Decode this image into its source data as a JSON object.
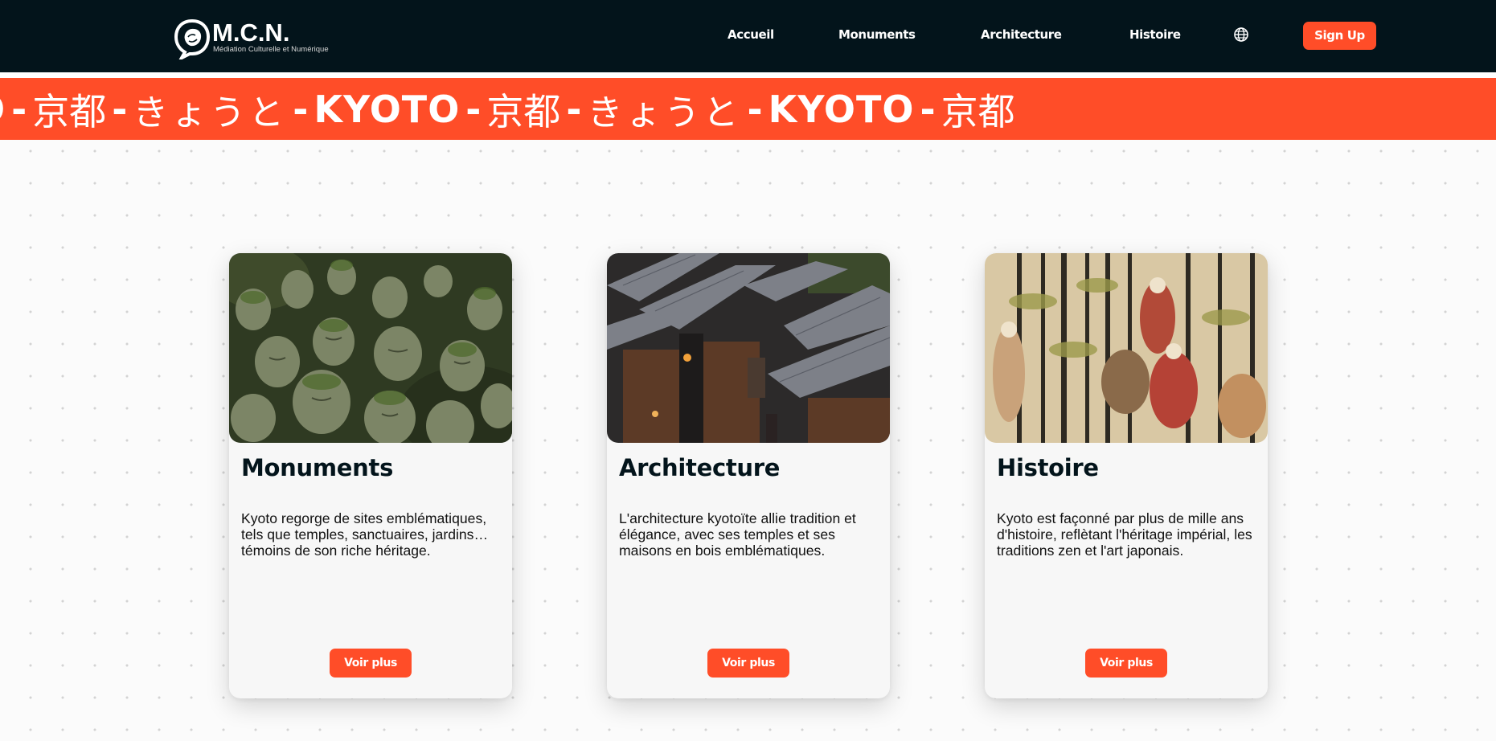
{
  "header": {
    "logo": {
      "title": "M.C.N.",
      "subtitle": "Médiation Culturelle et Numérique",
      "icon": "speech-bubble-logo"
    },
    "nav": [
      {
        "label": "Accueil"
      },
      {
        "label": "Monuments"
      },
      {
        "label": "Architecture"
      },
      {
        "label": "Histoire"
      }
    ],
    "language_icon": "globe-icon",
    "signup_label": "Sign Up"
  },
  "marquee": {
    "segments": [
      "O",
      "京都",
      "きょうと",
      "KYOTO",
      "京都",
      "きょうと",
      "KYOTO",
      "京都"
    ],
    "separator": "-"
  },
  "cards": [
    {
      "title": "Monuments",
      "text": "Kyoto regorge de sites emblématiques, tels que temples, sanctuaires, jardins…témoins de son riche héritage.",
      "button": "Voir plus",
      "image": "photo-moss-covered-stone-buddha-statues"
    },
    {
      "title": "Architecture",
      "text": "L'architecture kyotoïte allie tradition et élégance, avec ses temples et ses maisons en bois emblématiques.",
      "button": "Voir plus",
      "image": "photo-traditional-wooden-houses-tiled-roofs-dusk"
    },
    {
      "title": "Histoire",
      "text": "Kyoto est façonné par plus de mille ans d'histoire, reflètant l'héritage impérial, les traditions zen et l'art japonais.",
      "button": "Voir plus",
      "image": "ukiyo-e-women-in-bamboo-grove"
    }
  ],
  "colors": {
    "navbar": "#03141b",
    "accent": "#ff4d28",
    "card": "#f7f7f7",
    "background": "#fbfbfb"
  }
}
